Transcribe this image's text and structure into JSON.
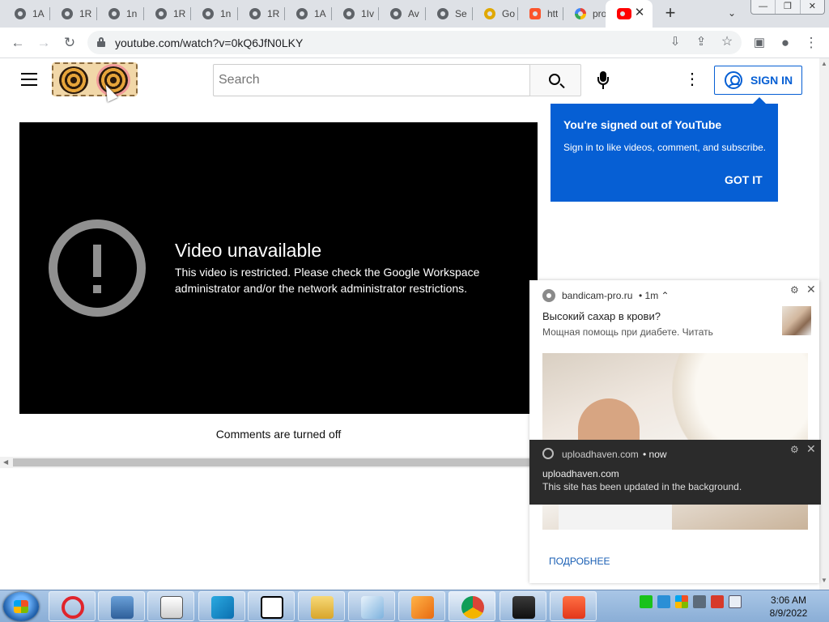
{
  "browser": {
    "tabs": [
      {
        "title": "1A"
      },
      {
        "title": "1R"
      },
      {
        "title": "1n"
      },
      {
        "title": "1R"
      },
      {
        "title": "1n"
      },
      {
        "title": "1R"
      },
      {
        "title": "1A"
      },
      {
        "title": "1Iv"
      },
      {
        "title": "Av"
      },
      {
        "title": "Se"
      },
      {
        "title": "Go"
      },
      {
        "title": "htt"
      },
      {
        "title": "pro"
      },
      {
        "title": ""
      }
    ],
    "new_tab_label": "+",
    "url": "youtube.com/watch?v=0kQ6JfN0LKY"
  },
  "youtube": {
    "search_placeholder": "Search",
    "sign_in_label": "SIGN IN",
    "popup": {
      "title": "You're signed out of YouTube",
      "text": "Sign in to like videos, comment, and subscribe.",
      "button": "GOT IT"
    },
    "player": {
      "error_title": "Video unavailable",
      "error_text": "This video is restricted. Please check the Google Workspace administrator and/or the network administrator restrictions."
    },
    "comments_status": "Comments are turned off"
  },
  "notifications": [
    {
      "site": "bandicam-pro.ru",
      "time": "• 1m ⌃",
      "title": "Высокий сахар в крови?",
      "body": "Мощная помощь при диабете. Читать",
      "action": "ПОДРОБНЕЕ"
    },
    {
      "site": "uploadhaven.com",
      "time": "• now",
      "title": "uploadhaven.com",
      "body": "This site has been updated in the background."
    }
  ],
  "taskbar": {
    "time": "3:06 AM",
    "date": "8/9/2022"
  },
  "colors": {
    "accent": "#065fd4",
    "player_bg": "#000000",
    "taskbar": "#8aaed6"
  }
}
